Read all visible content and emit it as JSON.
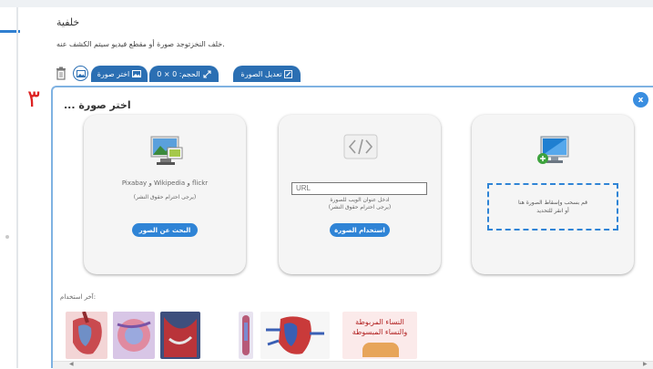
{
  "page": {
    "heading": "خلفية",
    "description": "خلف النخزتوجد صورة أو مقطع فيديو سيتم الكشف عنه."
  },
  "toolbar": {
    "edit_image_label": "تعديل الصورة",
    "size_label": "الحجم: 0 × 0",
    "choose_image_label": "اختر صورة",
    "icons": [
      "pencil-icon",
      "resize-icon",
      "image-icon",
      "picture-circle-icon",
      "trash-icon"
    ]
  },
  "annotation": {
    "step_number": "٣"
  },
  "modal": {
    "title": "... اختر صورة",
    "close_label": "x",
    "cards": {
      "search": {
        "sources": "Pixabay و Wikipedia و flickr",
        "note": "(يرجى احترام حقوق النشر)",
        "button": "البحث عن الصور"
      },
      "url": {
        "url_placeholder": "URL",
        "hint_line1": "ادخل عنوان الويب للصورة",
        "hint_line2": "(يرجى احترام حقوق النشر)",
        "button": "استخدام الصورة"
      },
      "upload": {
        "drop_line1": "قم بسحب وإسقاط الصورة هنا",
        "drop_line2": "أو انقر للتحديد"
      }
    },
    "recent_label": "آخر استخدام:",
    "recent_thumbs": [
      {
        "kind": "heart-diagram",
        "caption": ""
      },
      {
        "kind": "heart-chamber",
        "caption": ""
      },
      {
        "kind": "heart-valve",
        "caption": ""
      },
      {
        "kind": "heart-strip",
        "caption": ""
      },
      {
        "kind": "circulation-diagram",
        "caption": ""
      },
      {
        "kind": "text-tile",
        "caption": "النساء المربوطة\nوالنساء المبسوطة"
      }
    ]
  },
  "colors": {
    "accent": "#2b6fb3",
    "button_blue": "#2f84d6",
    "modal_border": "#7fb2e2",
    "annotation_red": "#dd2222"
  }
}
